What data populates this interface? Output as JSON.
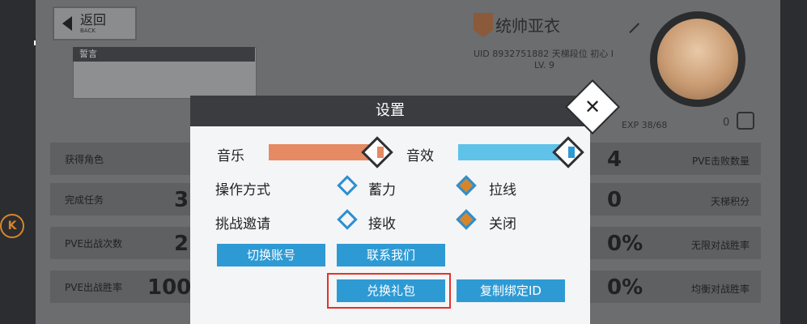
{
  "back": {
    "label_cn": "返回",
    "label_en": "BACK"
  },
  "oath": {
    "title": "誓言"
  },
  "profile": {
    "name": "统帅亚衣",
    "uid_line": "UID 8932751882  天梯段位 初心 I",
    "level": "LV. 9",
    "exp": "EXP 38/68",
    "likes": "0"
  },
  "left_stats": [
    {
      "label": "获得角色",
      "value": ""
    },
    {
      "label": "完成任务",
      "value": "3"
    },
    {
      "label": "PVE出战次数",
      "value": "2"
    },
    {
      "label": "PVE出战胜率",
      "value": "100%"
    }
  ],
  "right_stats": [
    {
      "label": "PVE击败数量",
      "value": "4"
    },
    {
      "label": "天梯积分",
      "value": "0"
    },
    {
      "label": "无限对战胜率",
      "value": "0%"
    },
    {
      "label": "均衡对战胜率",
      "value": "0%"
    }
  ],
  "side": {
    "k_label": "K"
  },
  "dialog": {
    "title": "设置",
    "close": "✕",
    "music_label": "音乐",
    "music_level": 1.0,
    "sfx_label": "音效",
    "sfx_level": 1.0,
    "control_label": "操作方式",
    "control_options": [
      "蓄力",
      "拉线"
    ],
    "control_selected": "拉线",
    "invite_label": "挑战邀请",
    "invite_options": [
      "接收",
      "关闭"
    ],
    "invite_selected": "关闭",
    "buttons": {
      "switch_account": "切换账号",
      "contact_us": "联系我们",
      "redeem_gift": "兑换礼包",
      "copy_bind_id": "复制绑定ID"
    }
  },
  "colors": {
    "accent_blue": "#2e9ad4",
    "music_orange": "#e58a63",
    "sfx_blue": "#5fc2e8",
    "highlight_red": "#e0342a"
  }
}
